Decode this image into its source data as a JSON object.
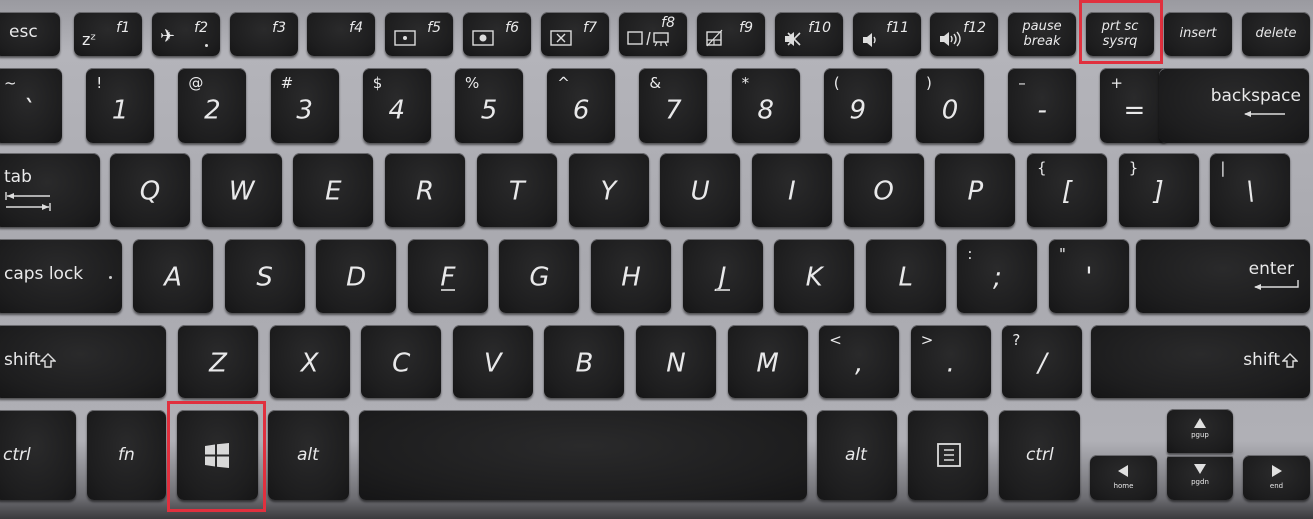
{
  "keyboard": {
    "highlight_color": "#e0303e",
    "highlighted_keys": [
      "prt sc sysrq",
      "windows"
    ],
    "function_row": {
      "esc": "esc",
      "f1": {
        "fn": "f1",
        "icon": "sleep-icon",
        "glyph": "zᶻ"
      },
      "f2": {
        "fn": "f2",
        "icon": "airplane-mode-icon",
        "glyph": "✈"
      },
      "f3": {
        "fn": "f3"
      },
      "f4": {
        "fn": "f4"
      },
      "f5": {
        "fn": "f5",
        "icon": "brightness-down-icon"
      },
      "f6": {
        "fn": "f6",
        "icon": "brightness-up-icon"
      },
      "f7": {
        "fn": "f7",
        "icon": "display-off-icon"
      },
      "f8": {
        "fn": "f8",
        "icon": "display-projector-icon"
      },
      "f9": {
        "fn": "f9",
        "icon": "touchpad-toggle-icon"
      },
      "f10": {
        "fn": "f10",
        "icon": "mute-icon"
      },
      "f11": {
        "fn": "f11",
        "icon": "volume-down-icon"
      },
      "f12": {
        "fn": "f12",
        "icon": "volume-up-icon"
      },
      "pause": {
        "line1": "pause",
        "line2": "break"
      },
      "prtsc": {
        "line1": "prt sc",
        "line2": "sysrq"
      },
      "insert": "insert",
      "delete": "delete"
    },
    "number_row": [
      {
        "main": "`",
        "shift": "~"
      },
      {
        "main": "1",
        "shift": "!"
      },
      {
        "main": "2",
        "shift": "@"
      },
      {
        "main": "3",
        "shift": "#"
      },
      {
        "main": "4",
        "shift": "$"
      },
      {
        "main": "5",
        "shift": "%"
      },
      {
        "main": "6",
        "shift": "^"
      },
      {
        "main": "7",
        "shift": "&"
      },
      {
        "main": "8",
        "shift": "*"
      },
      {
        "main": "9",
        "shift": "("
      },
      {
        "main": "0",
        "shift": ")"
      },
      {
        "main": "-",
        "shift": "–"
      },
      {
        "main": "=",
        "shift": "+"
      }
    ],
    "backspace": "backspace",
    "tab": "tab",
    "qwerty_row": [
      {
        "main": "Q"
      },
      {
        "main": "W"
      },
      {
        "main": "E"
      },
      {
        "main": "R"
      },
      {
        "main": "T"
      },
      {
        "main": "Y"
      },
      {
        "main": "U"
      },
      {
        "main": "I"
      },
      {
        "main": "O"
      },
      {
        "main": "P"
      },
      {
        "main": "[",
        "shift": "{"
      },
      {
        "main": "]",
        "shift": "}"
      },
      {
        "main": "\\",
        "shift": "|"
      }
    ],
    "caps_lock": "caps lock",
    "home_row": [
      {
        "main": "A"
      },
      {
        "main": "S"
      },
      {
        "main": "D"
      },
      {
        "main": "F"
      },
      {
        "main": "G"
      },
      {
        "main": "H"
      },
      {
        "main": "J"
      },
      {
        "main": "K"
      },
      {
        "main": "L"
      },
      {
        "main": ";",
        "shift": ":"
      },
      {
        "main": "'",
        "shift": "\""
      }
    ],
    "enter": "enter",
    "shift_left": "shift",
    "shift_right": "shift",
    "bottom_letter_row": [
      {
        "main": "Z"
      },
      {
        "main": "X"
      },
      {
        "main": "C"
      },
      {
        "main": "V"
      },
      {
        "main": "B"
      },
      {
        "main": "N"
      },
      {
        "main": "M"
      },
      {
        "main": ",",
        "shift": "<"
      },
      {
        "main": ".",
        "shift": ">"
      },
      {
        "main": "/",
        "shift": "?"
      }
    ],
    "ctrl_left": "ctrl",
    "fn": "fn",
    "alt_left": "alt",
    "alt_right": "alt",
    "ctrl_right": "ctrl",
    "arrows": {
      "up": "pgup",
      "down": "pgdn",
      "left": "home",
      "right": "end"
    }
  }
}
